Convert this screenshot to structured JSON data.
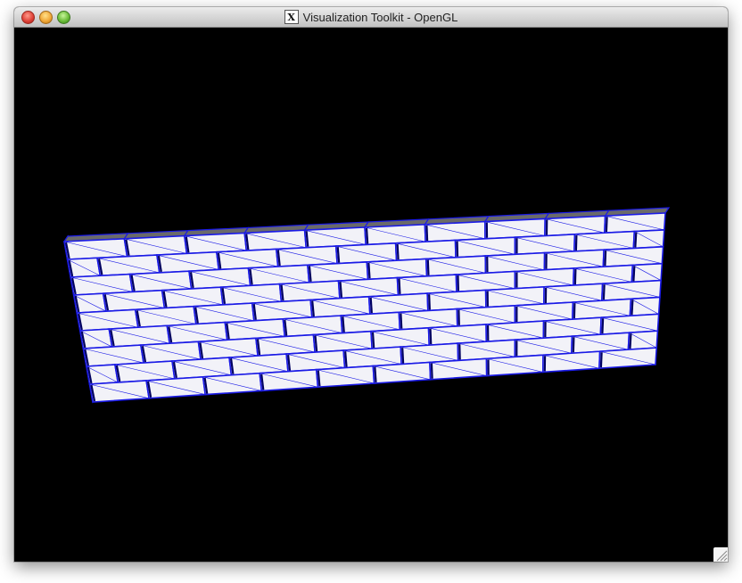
{
  "window": {
    "title": "Visualization Toolkit - OpenGL",
    "title_icon": "X",
    "buttons": [
      "close",
      "minimize",
      "zoom"
    ]
  },
  "scene": {
    "description_icon": "brick-wall-render",
    "brick_face_color": "#f2f2f8",
    "brick_top_color": "#6a6a6a",
    "edge_color": "#1a1ae6",
    "background_color": "#000000",
    "rows": 9,
    "bricks_top_row": 10
  }
}
